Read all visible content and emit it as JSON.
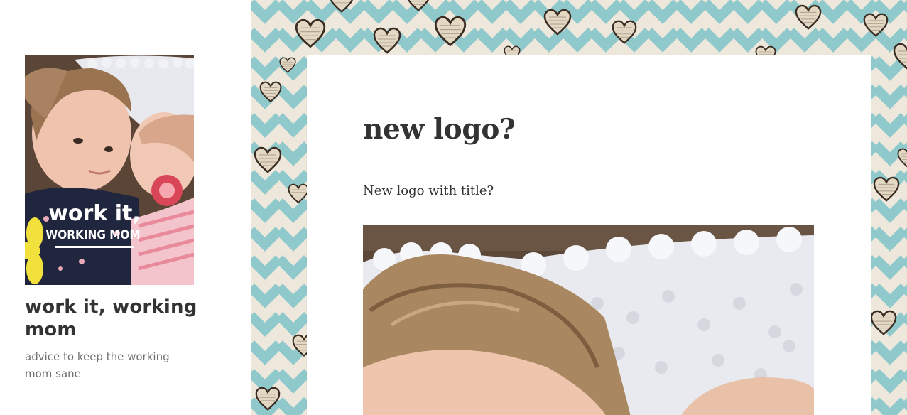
{
  "site": {
    "title": "work it, working mom",
    "description": "advice to keep the working mom sane",
    "logo": {
      "overlay_line1": "work it,",
      "overlay_line2": "WORKING MOM"
    }
  },
  "post": {
    "title": "new logo?",
    "text": "New logo with title?"
  },
  "colors": {
    "chevron_teal": "#8fc9cc",
    "chevron_cream": "#f1ece0",
    "title_text": "#333333",
    "description_text": "#707070"
  }
}
